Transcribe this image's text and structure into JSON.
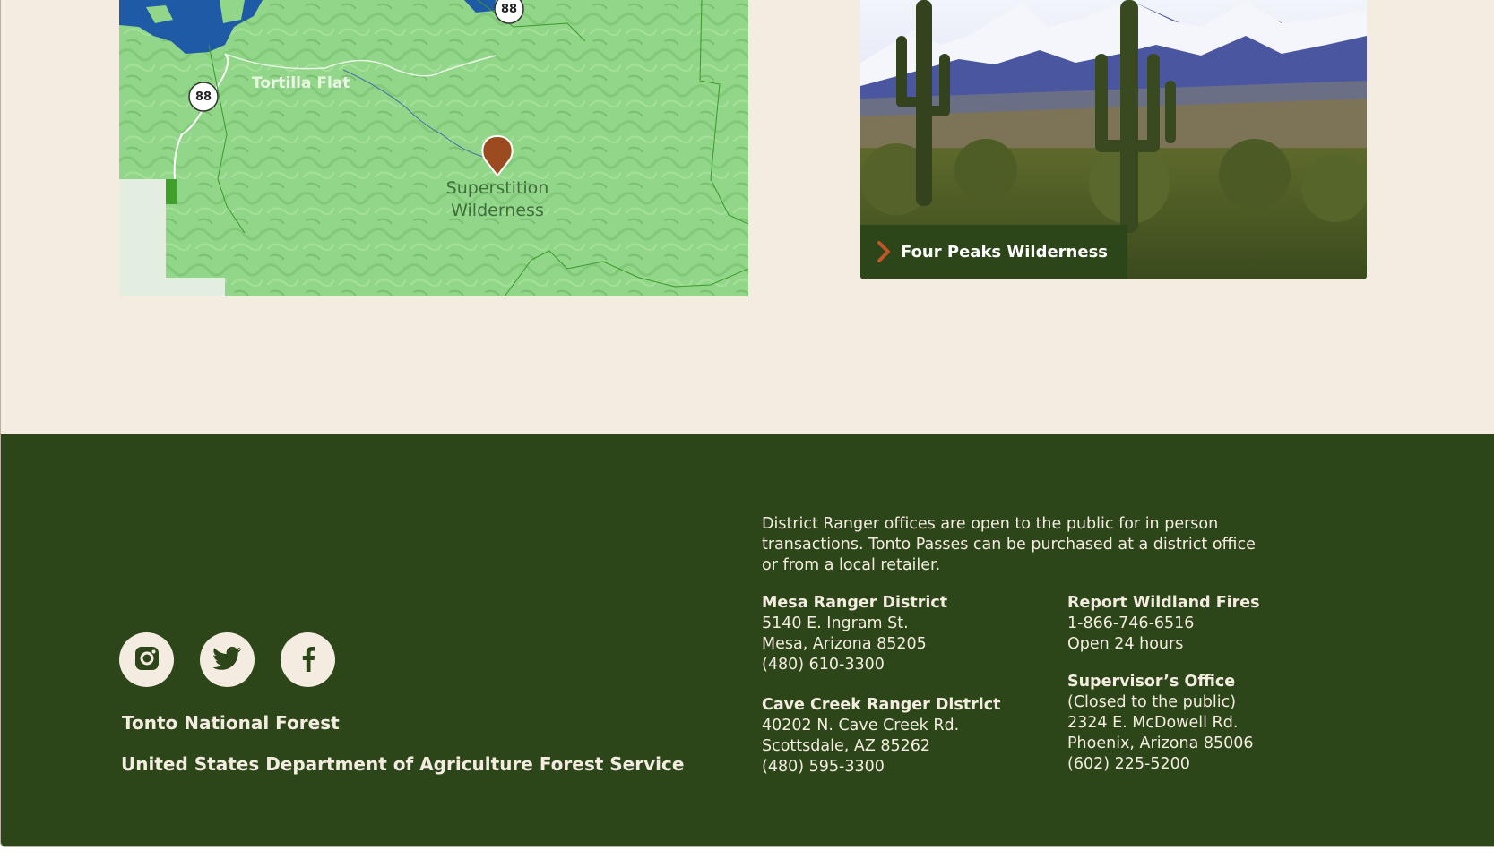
{
  "map": {
    "place_labels": [
      "Tortilla Flat",
      "Superstition",
      "Wilderness"
    ],
    "road_shields": [
      "88",
      "88"
    ],
    "marker": "location-pin"
  },
  "feature_card": {
    "label": "Four Peaks Wilderness",
    "icon": "chevron-right-icon"
  },
  "footer": {
    "social": [
      {
        "name": "instagram",
        "icon": "instagram-icon"
      },
      {
        "name": "twitter",
        "icon": "twitter-icon"
      },
      {
        "name": "facebook",
        "icon": "facebook-icon"
      }
    ],
    "org_name": "Tonto National Forest",
    "agency": "United States Department of Agriculture Forest Service",
    "notice": "District Ranger offices are open to the public for in person transactions. Tonto Passes can be purchased at a district office or from a local retailer.",
    "mesa": {
      "title": "Mesa Ranger District",
      "address1": "5140 E. Ingram St.",
      "address2": "Mesa, Arizona 85205",
      "phone": "(480) 610-3300"
    },
    "cave_creek": {
      "title": "Cave Creek Ranger District",
      "address1": "40202 N. Cave Creek Rd.",
      "address2": "Scottsdale, AZ 85262",
      "phone": "(480) 595-3300"
    },
    "wildfires": {
      "title": "Report Wildland Fires",
      "phone": "1-866-746-6516",
      "hours": "Open 24 hours"
    },
    "supervisor": {
      "title": "Supervisor’s Office",
      "note": "(Closed to the public)",
      "address1": "2324 E. McDowell Rd.",
      "address2": "Phoenix, Arizona 85006",
      "phone": "(602) 225-5200"
    }
  },
  "colors": {
    "page_bg": "#f4ece0",
    "footer_bg": "#2c4519",
    "marker": "#9c4a1f",
    "map_green": "#8fd486"
  }
}
